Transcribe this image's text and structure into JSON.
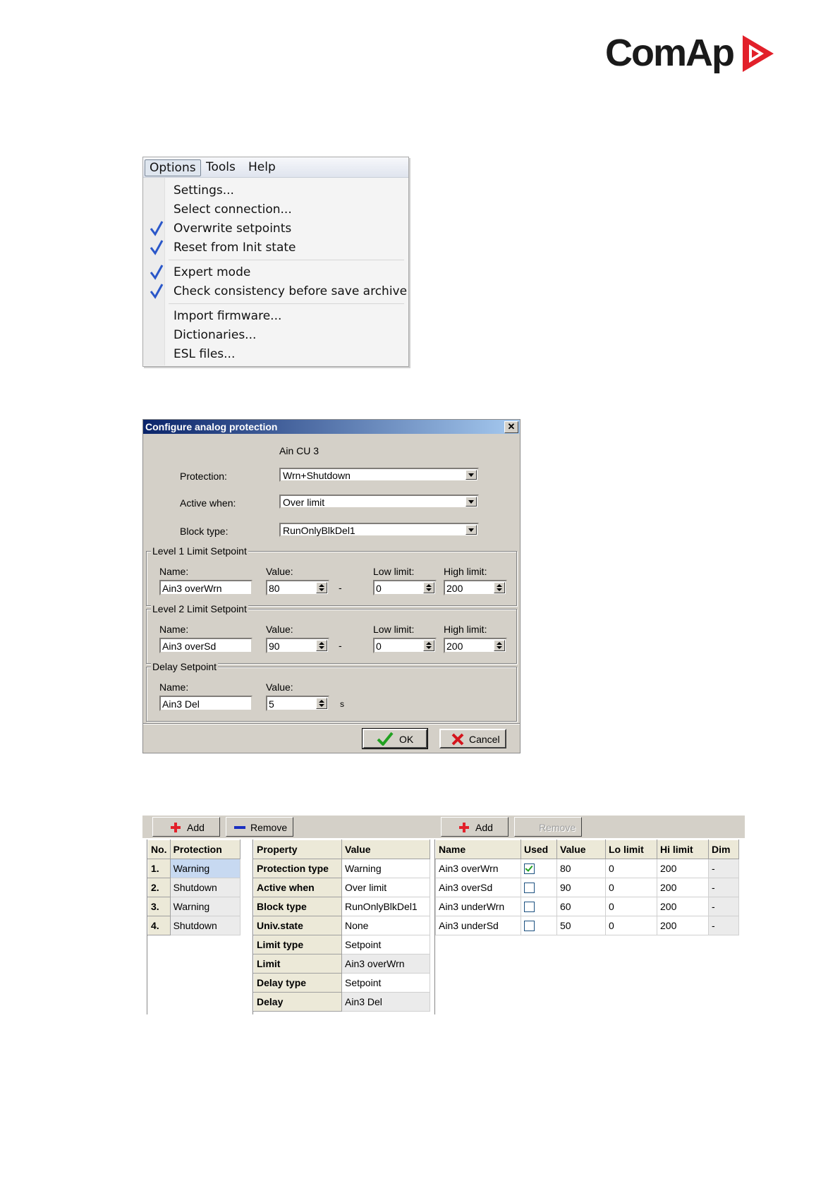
{
  "logo": {
    "text": "ComAp"
  },
  "options_menu": {
    "menubar": [
      "Options",
      "Tools",
      "Help"
    ],
    "groups": [
      [
        {
          "label": "Settings...",
          "checked": false
        },
        {
          "label": "Select connection...",
          "checked": false
        },
        {
          "label": "Overwrite setpoints",
          "checked": true
        },
        {
          "label": "Reset from Init state",
          "checked": true
        }
      ],
      [
        {
          "label": "Expert mode",
          "checked": true
        },
        {
          "label": "Check consistency before save archive",
          "checked": true
        }
      ],
      [
        {
          "label": "Import firmware...",
          "checked": false
        },
        {
          "label": "Dictionaries...",
          "checked": false
        },
        {
          "label": "ESL files...",
          "checked": false
        }
      ]
    ]
  },
  "dialog": {
    "title": "Configure analog protection",
    "close": "✕",
    "input_name": "Ain CU 3",
    "protection_label": "Protection:",
    "protection_value": "Wrn+Shutdown",
    "active_label": "Active when:",
    "active_value": "Over limit",
    "block_label": "Block type:",
    "block_value": "RunOnlyBlkDel1",
    "level1": {
      "title": "Level 1 Limit Setpoint",
      "name_label": "Name:",
      "value_label": "Value:",
      "low_label": "Low limit:",
      "high_label": "High limit:",
      "name": "Ain3 overWrn",
      "value": "80",
      "unit": "-",
      "low": "0",
      "high": "200"
    },
    "level2": {
      "title": "Level 2 Limit Setpoint",
      "name_label": "Name:",
      "value_label": "Value:",
      "low_label": "Low limit:",
      "high_label": "High limit:",
      "name": "Ain3 overSd",
      "value": "90",
      "unit": "-",
      "low": "0",
      "high": "200"
    },
    "delay": {
      "title": "Delay Setpoint",
      "name_label": "Name:",
      "value_label": "Value:",
      "name": "Ain3 Del",
      "value": "5",
      "unit": "s"
    },
    "ok": "OK",
    "cancel": "Cancel"
  },
  "panels": {
    "toolbar": {
      "add1": "Add",
      "remove1": "Remove",
      "add2": "Add",
      "remove2": "Remove"
    },
    "protections": {
      "headers": [
        "No.",
        "Protection"
      ],
      "rows": [
        [
          "1.",
          "Warning"
        ],
        [
          "2.",
          "Shutdown"
        ],
        [
          "3.",
          "Warning"
        ],
        [
          "4.",
          "Shutdown"
        ]
      ]
    },
    "properties": {
      "headers": [
        "Property",
        "Value"
      ],
      "rows": [
        [
          "Protection type",
          "Warning"
        ],
        [
          "Active when",
          "Over limit"
        ],
        [
          "Block type",
          "RunOnlyBlkDel1"
        ],
        [
          "Univ.state",
          "None"
        ],
        [
          "Limit type",
          "Setpoint"
        ],
        [
          "Limit",
          "Ain3 overWrn"
        ],
        [
          "Delay type",
          "Setpoint"
        ],
        [
          "Delay",
          "Ain3 Del"
        ]
      ]
    },
    "setpoints": {
      "headers": [
        "Name",
        "Used",
        "Value",
        "Lo limit",
        "Hi limit",
        "Dim"
      ],
      "rows": [
        {
          "name": "Ain3 overWrn",
          "used": true,
          "value": "80",
          "lo": "0",
          "hi": "200",
          "dim": "-"
        },
        {
          "name": "Ain3 overSd",
          "used": false,
          "value": "90",
          "lo": "0",
          "hi": "200",
          "dim": "-"
        },
        {
          "name": "Ain3 underWrn",
          "used": false,
          "value": "60",
          "lo": "0",
          "hi": "200",
          "dim": "-"
        },
        {
          "name": "Ain3 underSd",
          "used": false,
          "value": "50",
          "lo": "0",
          "hi": "200",
          "dim": "-"
        }
      ]
    }
  },
  "colors": {
    "accent_red": "#e2202a",
    "title_blue": "#0a246a",
    "check_blue": "#2a57c9"
  }
}
